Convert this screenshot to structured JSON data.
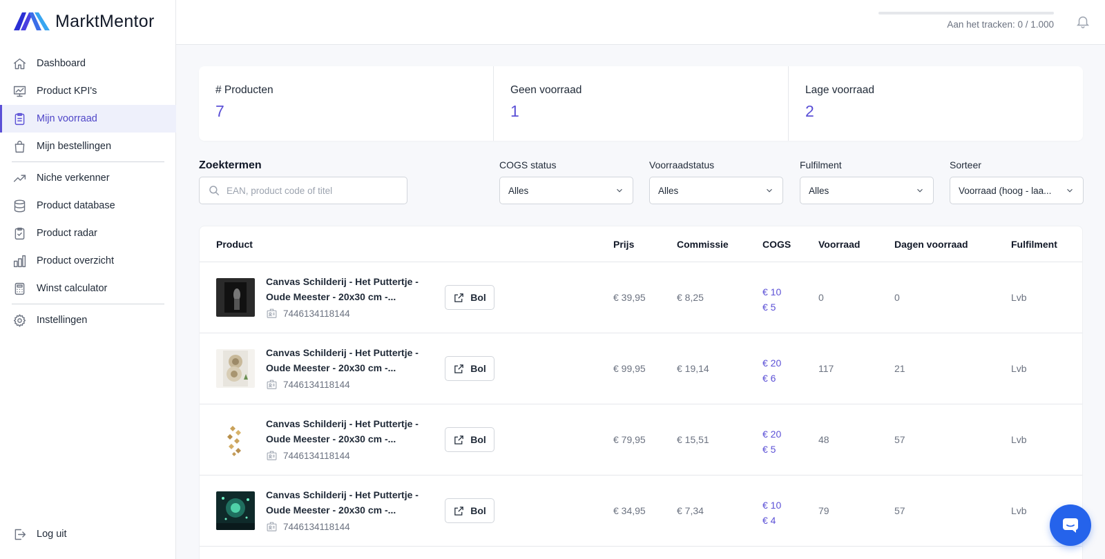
{
  "app": {
    "name": "MarktMentor"
  },
  "sidebar": {
    "items": [
      {
        "label": "Dashboard",
        "icon": "home-icon"
      },
      {
        "label": "Product KPI's",
        "icon": "presentation-chart-icon"
      },
      {
        "label": "Mijn voorraad",
        "icon": "clipboard-list-icon",
        "active": true
      },
      {
        "label": "Mijn bestellingen",
        "icon": "shopping-bag-icon"
      },
      {
        "label": "Niche verkenner",
        "icon": "trending-up-icon"
      },
      {
        "label": "Product database",
        "icon": "database-icon"
      },
      {
        "label": "Product radar",
        "icon": "clipboard-check-icon"
      },
      {
        "label": "Product overzicht",
        "icon": "bar-chart-icon"
      },
      {
        "label": "Winst calculator",
        "icon": "calculator-icon"
      },
      {
        "label": "Instellingen",
        "icon": "gear-icon"
      }
    ],
    "logout_label": "Log uit"
  },
  "topbar": {
    "tracking_text": "Aan het tracken: 0 / 1.000",
    "tracking_progress": 0
  },
  "stats": [
    {
      "label": "# Producten",
      "value": "7"
    },
    {
      "label": "Geen voorraad",
      "value": "1"
    },
    {
      "label": "Lage voorraad",
      "value": "2"
    }
  ],
  "filters": {
    "search_label": "Zoektermen",
    "search_placeholder": "EAN, product code of titel",
    "cogs_label": "COGS status",
    "cogs_value": "Alles",
    "voorraad_label": "Voorraadstatus",
    "voorraad_value": "Alles",
    "fulfilment_label": "Fulfilment",
    "fulfilment_value": "Alles",
    "sort_label": "Sorteer",
    "sort_value": "Voorraad (hoog - laa..."
  },
  "table": {
    "headers": {
      "product": "Product",
      "prijs": "Prijs",
      "commissie": "Commissie",
      "cogs": "COGS",
      "voorraad": "Voorraad",
      "dagen": "Dagen voorraad",
      "fulfilment": "Fulfilment"
    },
    "rows": [
      {
        "name_line1": "Canvas Schilderij - Het Puttertje -",
        "name_line2": "Oude Meester - 20x30 cm -...",
        "ean": "7446134118144",
        "button": "Bol",
        "prijs": "€ 39,95",
        "commissie": "€ 8,25",
        "cogs1": "€ 10",
        "cogs2": "€ 5",
        "voorraad": "0",
        "dagen": "0",
        "fulfilment": "Lvb"
      },
      {
        "name_line1": "Canvas Schilderij - Het Puttertje -",
        "name_line2": "Oude Meester - 20x30 cm -...",
        "ean": "7446134118144",
        "button": "Bol",
        "prijs": "€ 99,95",
        "commissie": "€ 19,14",
        "cogs1": "€ 20",
        "cogs2": "€ 6",
        "voorraad": "117",
        "dagen": "21",
        "fulfilment": "Lvb"
      },
      {
        "name_line1": "Canvas Schilderij - Het Puttertje -",
        "name_line2": "Oude Meester - 20x30 cm -...",
        "ean": "7446134118144",
        "button": "Bol",
        "prijs": "€ 79,95",
        "commissie": "€ 15,51",
        "cogs1": "€ 20",
        "cogs2": "€ 5",
        "voorraad": "48",
        "dagen": "57",
        "fulfilment": "Lvb"
      },
      {
        "name_line1": "Canvas Schilderij - Het Puttertje -",
        "name_line2": "Oude Meester - 20x30 cm -...",
        "ean": "7446134118144",
        "button": "Bol",
        "prijs": "€ 34,95",
        "commissie": "€ 7,34",
        "cogs1": "€ 10",
        "cogs2": "€ 4",
        "voorraad": "79",
        "dagen": "57",
        "fulfilment": "Lvb"
      }
    ]
  },
  "colors": {
    "accent": "#5b50d6",
    "chat": "#2563eb"
  }
}
